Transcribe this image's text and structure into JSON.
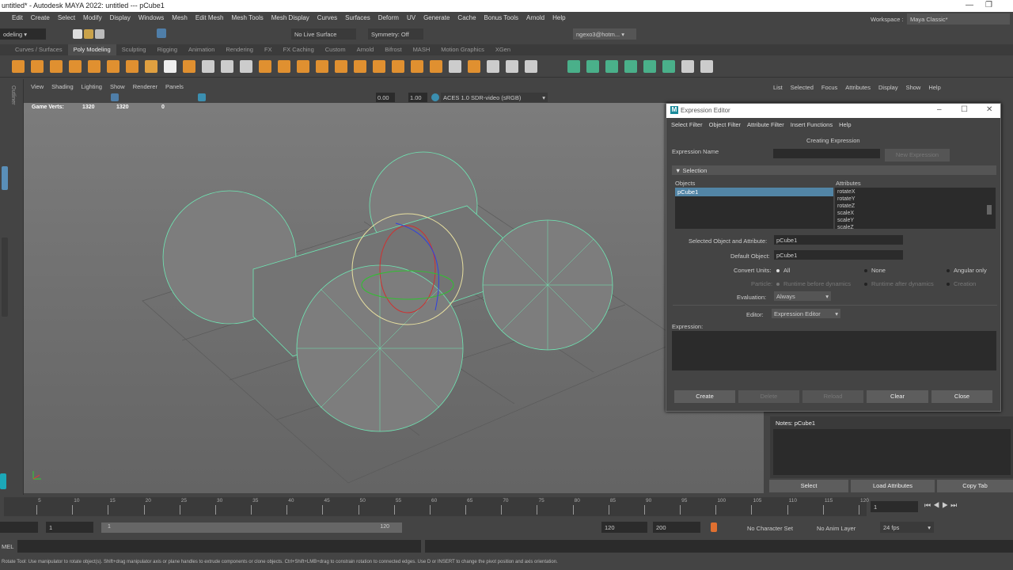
{
  "title": "untitled* - Autodesk MAYA 2022: untitled  ---  pCube1",
  "menubar": [
    "Edit",
    "Create",
    "Select",
    "Modify",
    "Display",
    "Windows",
    "Mesh",
    "Edit Mesh",
    "Mesh Tools",
    "Mesh Display",
    "Curves",
    "Surfaces",
    "Deform",
    "UV",
    "Generate",
    "Cache",
    "Bonus Tools",
    "Arnold",
    "Help"
  ],
  "status": {
    "menuset": "odeling",
    "live_surface": "No Live Surface",
    "symmetry": "Symmetry: Off",
    "user": "ngexo3@hotm...",
    "workspace_label": "Workspace :",
    "workspace": "Maya Classic*"
  },
  "shelf_tabs": [
    "Curves / Surfaces",
    "Poly Modeling",
    "Sculpting",
    "Rigging",
    "Animation",
    "Rendering",
    "FX",
    "FX Caching",
    "Custom",
    "Arnold",
    "Bifrost",
    "MASH",
    "Motion Graphics",
    "XGen"
  ],
  "viewport": {
    "menu": [
      "View",
      "Shading",
      "Lighting",
      "Show",
      "Renderer",
      "Panels"
    ],
    "exposure": "0.00",
    "gamma": "1.00",
    "colorspace": "ACES 1.0 SDR-video (sRGB)",
    "hud": {
      "label": "Game Verts:",
      "v1": "1320",
      "v2": "1320",
      "v3": "0"
    },
    "outliner_tab": "Outliner"
  },
  "right_panel": {
    "menu": [
      "List",
      "Selected",
      "Focus",
      "Attributes",
      "Display",
      "Show",
      "Help"
    ],
    "notes": "Notes:  pCube1",
    "buttons": [
      "Select",
      "Load Attributes",
      "Copy Tab"
    ]
  },
  "dialog": {
    "title": "Expression Editor",
    "menu": [
      "Select Filter",
      "Object Filter",
      "Attribute Filter",
      "Insert Functions",
      "Help"
    ],
    "heading": "Creating Expression",
    "expr_name_label": "Expression Name",
    "expr_name_value": "",
    "new_expression": "New Expression",
    "section": "Selection",
    "objects_label": "Objects",
    "objects": [
      "pCube1"
    ],
    "attributes_label": "Attributes",
    "attributes": [
      "rotateX",
      "rotateY",
      "rotateZ",
      "scaleX",
      "scaleY",
      "scaleZ"
    ],
    "sel_obj_attr_label": "Selected Object and Attribute:",
    "sel_obj_attr": "pCube1",
    "default_obj_label": "Default Object:",
    "default_obj": "pCube1",
    "convert_label": "Convert Units:",
    "convert": [
      "All",
      "None",
      "Angular only"
    ],
    "particle_label": "Particle:",
    "particle": [
      "Runtime before dynamics",
      "Runtime after dynamics",
      "Creation"
    ],
    "evaluation_label": "Evaluation:",
    "evaluation": "Always",
    "editor_label": "Editor:",
    "editor": "Expression Editor",
    "expression_label": "Expression:",
    "buttons": [
      "Create",
      "Delete",
      "Reload",
      "Clear",
      "Close"
    ]
  },
  "timeline": {
    "ticks": [
      5,
      10,
      15,
      20,
      25,
      30,
      35,
      40,
      45,
      50,
      55,
      60,
      65,
      70,
      75,
      80,
      85,
      90,
      95,
      100,
      105,
      110,
      115,
      120
    ],
    "min": 1,
    "max": 120,
    "current": "1"
  },
  "range": {
    "start": "1",
    "slider_start": "1",
    "slider_end": "120",
    "end": "120",
    "anim_end": "200",
    "character_set": "No Character Set",
    "anim_layer": "No Anim Layer",
    "fps": "24 fps"
  },
  "cmd": {
    "label": "MEL"
  },
  "help": "Rotate Tool: Use manipulator to rotate object(s). Shift+drag manipulator axis or plane handles to extrude components or clone objects. Ctrl+Shift+LMB+drag to constrain rotation to connected edges. Use D or INSERT to change the pivot position and axis orientation.",
  "colors": {
    "accent": "#4f7ea8",
    "wire": "#6ee8b4",
    "shelf_green": "#4ab08a"
  }
}
